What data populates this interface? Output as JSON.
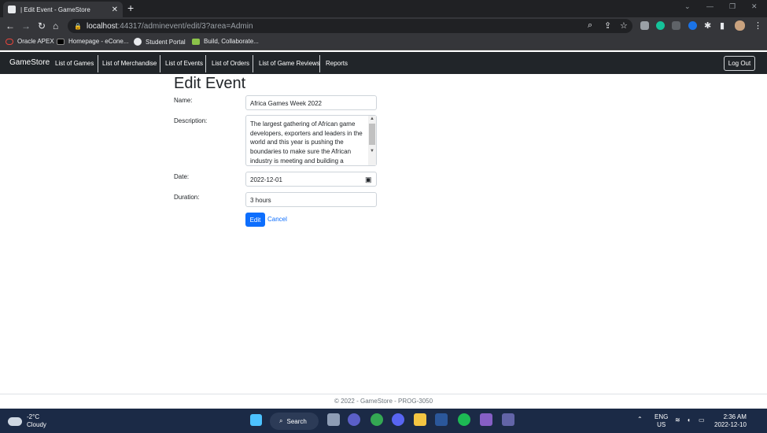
{
  "browser": {
    "tab_title": "| Edit Event - GameStore",
    "url_host": "localhost",
    "url_path": ":44317/adminevent/edit/3?area=Admin",
    "bookmarks": [
      "Oracle APEX",
      "Homepage - eCone...",
      "Student Portal",
      "Build, Collaborate..."
    ]
  },
  "navbar": {
    "brand": "GameStore",
    "links": [
      "List of Games",
      "List of Merchandise",
      "List of Events",
      "List of Orders",
      "List of Game Reviews",
      "Reports"
    ],
    "logout_label": "Log Out"
  },
  "form": {
    "title": "Edit Event",
    "name_label": "Name:",
    "name_value": "Africa Games Week 2022",
    "description_label": "Description:",
    "description_value": "The largest gathering of African game developers, exporters and leaders in the world and this year is pushing the boundaries to make sure the African industry is meeting and building a",
    "date_label": "Date:",
    "date_value": "2022-12-01",
    "duration_label": "Duration:",
    "duration_value": "3 hours",
    "edit_button": "Edit",
    "cancel_link": "Cancel"
  },
  "footer": {
    "text": "© 2022 - GameStore - PROG-3050"
  },
  "taskbar": {
    "weather_temp": "-2°C",
    "weather_desc": "Cloudy",
    "search_label": "Search",
    "lang_top": "ENG",
    "lang_bottom": "US",
    "time": "2:36 AM",
    "date": "2022-12-10"
  },
  "colors": {
    "primary": "#0d6efd",
    "navbar_bg": "#212529",
    "taskbar_bg": "#1b2a46"
  }
}
